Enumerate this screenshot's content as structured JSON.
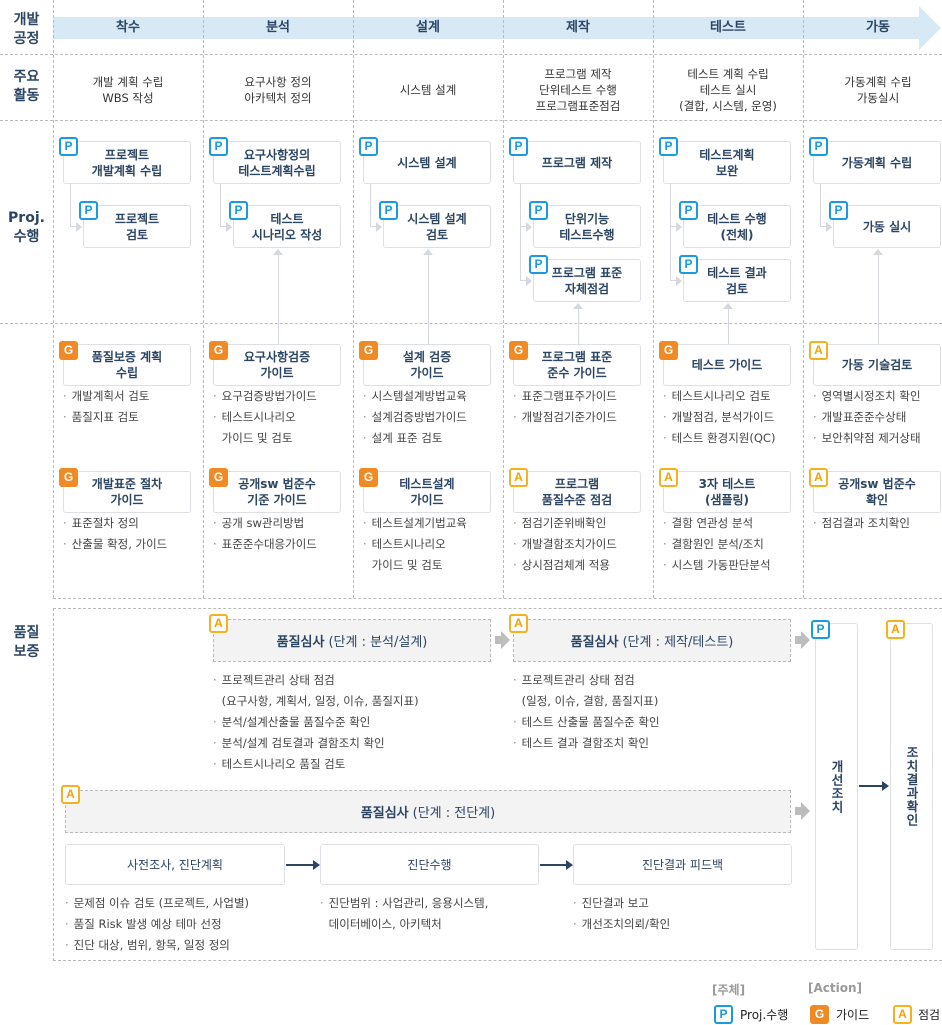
{
  "row_labels": {
    "process": "개발\n공정",
    "activities": "주요\n활동",
    "proj": "Proj.\n수행",
    "quality": "품질\n보증"
  },
  "columns": [
    {
      "phase": "착수",
      "activities": [
        "개발 계획 수립",
        "WBS 작성"
      ],
      "proj": [
        {
          "badge": "P",
          "text": [
            "프로젝트",
            "개발계획 수립"
          ]
        },
        {
          "badge": "P",
          "text": [
            "프로젝트",
            "검토"
          ]
        }
      ],
      "guides": [
        {
          "badge": "G",
          "title": [
            "품질보증 계획",
            "수립"
          ],
          "bullets": [
            [
              "개발계획서 검토"
            ],
            [
              "품질지표 검토"
            ]
          ]
        },
        {
          "badge": "G",
          "title": [
            "개발표준 절차",
            "가이드"
          ],
          "bullets": [
            [
              "표준절차 정의"
            ],
            [
              "산출물 확정, 가이드"
            ]
          ]
        }
      ]
    },
    {
      "phase": "분석",
      "activities": [
        "요구사항 정의",
        "아카텍처 정의"
      ],
      "proj": [
        {
          "badge": "P",
          "text": [
            "요구사항정의",
            "테스트계획수립"
          ]
        },
        {
          "badge": "P",
          "text": [
            "테스트",
            "시나리오 작성"
          ]
        }
      ],
      "guides": [
        {
          "badge": "G",
          "title": [
            "요구사항검증",
            "가이트"
          ],
          "bullets": [
            [
              "요구검증방법가이드"
            ],
            [
              "테스트시나리오",
              "가이드 및 검토"
            ]
          ]
        },
        {
          "badge": "G",
          "title": [
            "공개sw 법준수",
            "기준 가이드"
          ],
          "bullets": [
            [
              "공개 sw관리방법"
            ],
            [
              "표준준수대응가이드"
            ]
          ]
        }
      ]
    },
    {
      "phase": "설계",
      "activities": [
        "시스템 설계"
      ],
      "proj": [
        {
          "badge": "P",
          "text": [
            "시스템 설계"
          ]
        },
        {
          "badge": "P",
          "text": [
            "시스템 설계",
            "검토"
          ]
        }
      ],
      "guides": [
        {
          "badge": "G",
          "title": [
            "설계 검증",
            "가이드"
          ],
          "bullets": [
            [
              "시스템설계방법교육"
            ],
            [
              "설계검증방법가이드"
            ],
            [
              "설계 표준 검토"
            ]
          ]
        },
        {
          "badge": "G",
          "title": [
            "테스트설계",
            "가이드"
          ],
          "bullets": [
            [
              "테스트설계기법교육"
            ],
            [
              "테스트시나리오",
              "가이드 및 검토"
            ]
          ]
        }
      ]
    },
    {
      "phase": "제작",
      "activities": [
        "프로그램 제작",
        "단위테스트 수행",
        "프로그램표준점검"
      ],
      "proj": [
        {
          "badge": "P",
          "text": [
            "프로그램 제작"
          ]
        },
        {
          "badge": "P",
          "text": [
            "단위기능",
            "테스트수행"
          ]
        },
        {
          "badge": "P",
          "text": [
            "프로그램 표준",
            "자체점검"
          ]
        }
      ],
      "guides": [
        {
          "badge": "G",
          "title": [
            "프로그램 표준",
            "준수 가이드"
          ],
          "bullets": [
            [
              "표준그램표주가이드"
            ],
            [
              "개발점검기준가이드"
            ]
          ]
        },
        {
          "badge": "A",
          "title": [
            "프로그램",
            "품질수준 점검"
          ],
          "bullets": [
            [
              "점검기준위배확인"
            ],
            [
              "개발결함조치가이드"
            ],
            [
              "상시점검체계 적용"
            ]
          ]
        }
      ]
    },
    {
      "phase": "테스트",
      "activities": [
        "테스트 계획 수립",
        "테스트 실시",
        "(결합, 시스템, 운영)"
      ],
      "proj": [
        {
          "badge": "P",
          "text": [
            "테스트계획",
            "보완"
          ]
        },
        {
          "badge": "P",
          "text": [
            "테스트 수행",
            "(전체)"
          ]
        },
        {
          "badge": "P",
          "text": [
            "테스트 결과",
            "검토"
          ]
        }
      ],
      "guides": [
        {
          "badge": "G",
          "title": [
            "테스트 가이드"
          ],
          "bullets": [
            [
              "테스트시나리오 검토"
            ],
            [
              "개발점검, 분석가이드"
            ],
            [
              "테스트 환경지원(QC)"
            ]
          ]
        },
        {
          "badge": "A",
          "title": [
            "3자 테스트",
            "(샘플링)"
          ],
          "bullets": [
            [
              "결함 연관성 분석"
            ],
            [
              "결함원인 분석/조치"
            ],
            [
              "시스템 가동판단분석"
            ]
          ]
        }
      ]
    },
    {
      "phase": "가동",
      "activities": [
        "가동계획 수립",
        "가동실시"
      ],
      "proj": [
        {
          "badge": "P",
          "text": [
            "가동계획 수립"
          ]
        },
        {
          "badge": "P",
          "text": [
            "가동 실시"
          ]
        }
      ],
      "guides": [
        {
          "badge": "A",
          "title": [
            "가동 기술검토"
          ],
          "bullets": [
            [
              "영역별시정조치 확인"
            ],
            [
              "개발표준준수상태"
            ],
            [
              "보안취약점 제거상태"
            ]
          ]
        },
        {
          "badge": "A",
          "title": [
            "공개sw 법준수",
            "확인"
          ],
          "bullets": [
            [
              "점검결과 조치확인"
            ]
          ]
        }
      ]
    }
  ],
  "quality": {
    "review1": {
      "badge": "A",
      "title": "품질심사",
      "stage": "(단계 : 분석/설계)",
      "bullets": [
        [
          "프로젝트관리 상태 점검",
          "(요구사항, 계획서, 일정, 이슈, 품질지표)"
        ],
        [
          "분석/설계산출물 품질수준 확인"
        ],
        [
          "분석/설계 검토결과 결함조치 확인"
        ],
        [
          "테스트시나리오 품질 검토"
        ]
      ]
    },
    "review2": {
      "badge": "A",
      "title": "품질심사",
      "stage": "(단계 : 제작/테스트)",
      "bullets": [
        [
          "프로젝트관리 상태 점검",
          "(일정, 이슈, 결함, 품질지표)"
        ],
        [
          "테스트 산출물 품질수준 확인"
        ],
        [
          "테스트 결과 결함조치 확인"
        ]
      ]
    },
    "review3": {
      "badge": "A",
      "title": "품질심사",
      "stage": "(단계 : 전단계)"
    },
    "steps": [
      {
        "label": "사전조사, 진단계획",
        "bullets": [
          [
            "문제점 이슈 검토 (프로젝트, 사업별)"
          ],
          [
            "품질 Risk 발생 예상 테마 선정"
          ],
          [
            "진단 대상, 범위, 항목, 일정 정의"
          ]
        ]
      },
      {
        "label": "진단수행",
        "bullets": [
          [
            "진단범위 : 사업관리, 응용시스템,",
            "데이터베이스, 아키텍처"
          ]
        ]
      },
      {
        "label": "진단결과 피드백",
        "bullets": [
          [
            "진단결과 보고"
          ],
          [
            "개선조치의뢰/확인"
          ]
        ]
      }
    ],
    "improve": {
      "badge": "P",
      "label": "개선조치"
    },
    "confirm": {
      "badge": "A",
      "label": "조치결과확인"
    }
  },
  "legend": {
    "subject_header": "[주체]",
    "action_header": "[Action]",
    "items": [
      {
        "badge": "P",
        "label": "Proj.수행"
      },
      {
        "badge": "G",
        "label": "가이드"
      },
      {
        "badge": "A",
        "label": "점검"
      }
    ]
  },
  "colors": {
    "P": "#1a9be0",
    "G": "#f08a24",
    "A": "#f5b120",
    "header_band": "#d6e9f5",
    "title": "#2c4563"
  }
}
